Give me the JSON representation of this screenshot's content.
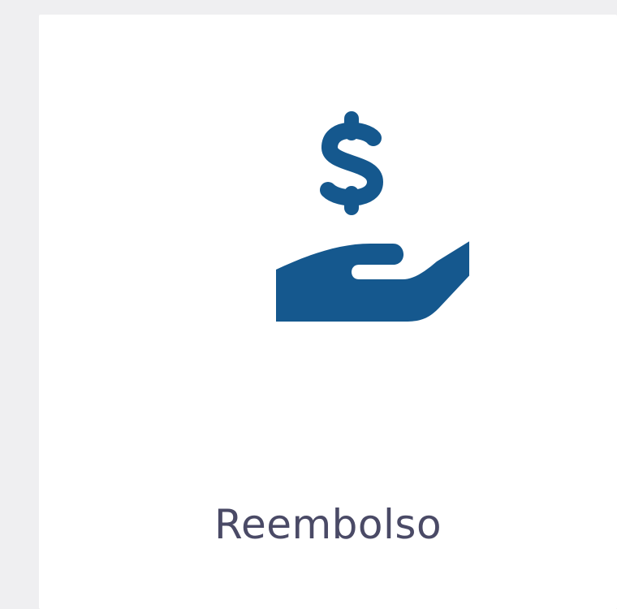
{
  "card": {
    "label": "Reembolso",
    "icon": "hand-holding-dollar-icon",
    "icon_color": "#15588e",
    "label_color": "#4a4a66"
  }
}
